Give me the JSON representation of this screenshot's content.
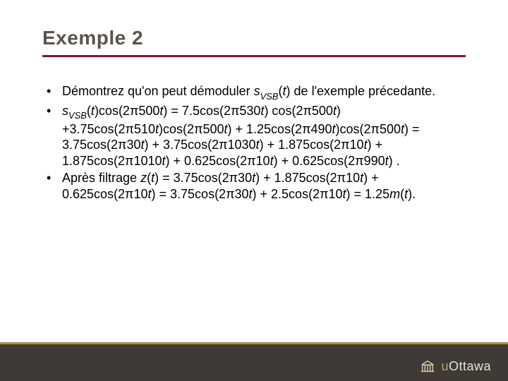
{
  "title": "Exemple 2",
  "bullets": {
    "b1_pre": "Démontrez qu'on peut démoduler ",
    "b1_s": "s",
    "b1_sub": "VSB",
    "b1_post": "(",
    "b1_t": "t",
    "b1_post2": ") de l'exemple précedante.",
    "b2_html": "s<sub>VSB</sub>(t)cos(2π500t) = 7.5cos(2π530t) cos(2π500t) +3.75cos(2π510t)cos(2π500t) + 1.25cos(2π490t)cos(2π500t) = 3.75cos(2π30t) + 3.75cos(2π1030t)  + 1.875cos(2π10t) + 1.875cos(2π1010t) + 0.625cos(2π10t) + 0.625cos(2π990t) .",
    "b3_html": "Après filtrage z(t) = 3.75cos(2π30t) + 1.875cos(2π10t) + 0.625cos(2π10t) = 3.75cos(2π30t) + 2.5cos(2π10t) = 1.25m(t)."
  },
  "logo": {
    "u": "u",
    "name": "Ottawa",
    "icon": "pavilion-icon"
  },
  "colors": {
    "title": "#5c534d",
    "accent": "#8a0f2d",
    "gold": "#b08c3d",
    "footer": "#3f3a36"
  }
}
